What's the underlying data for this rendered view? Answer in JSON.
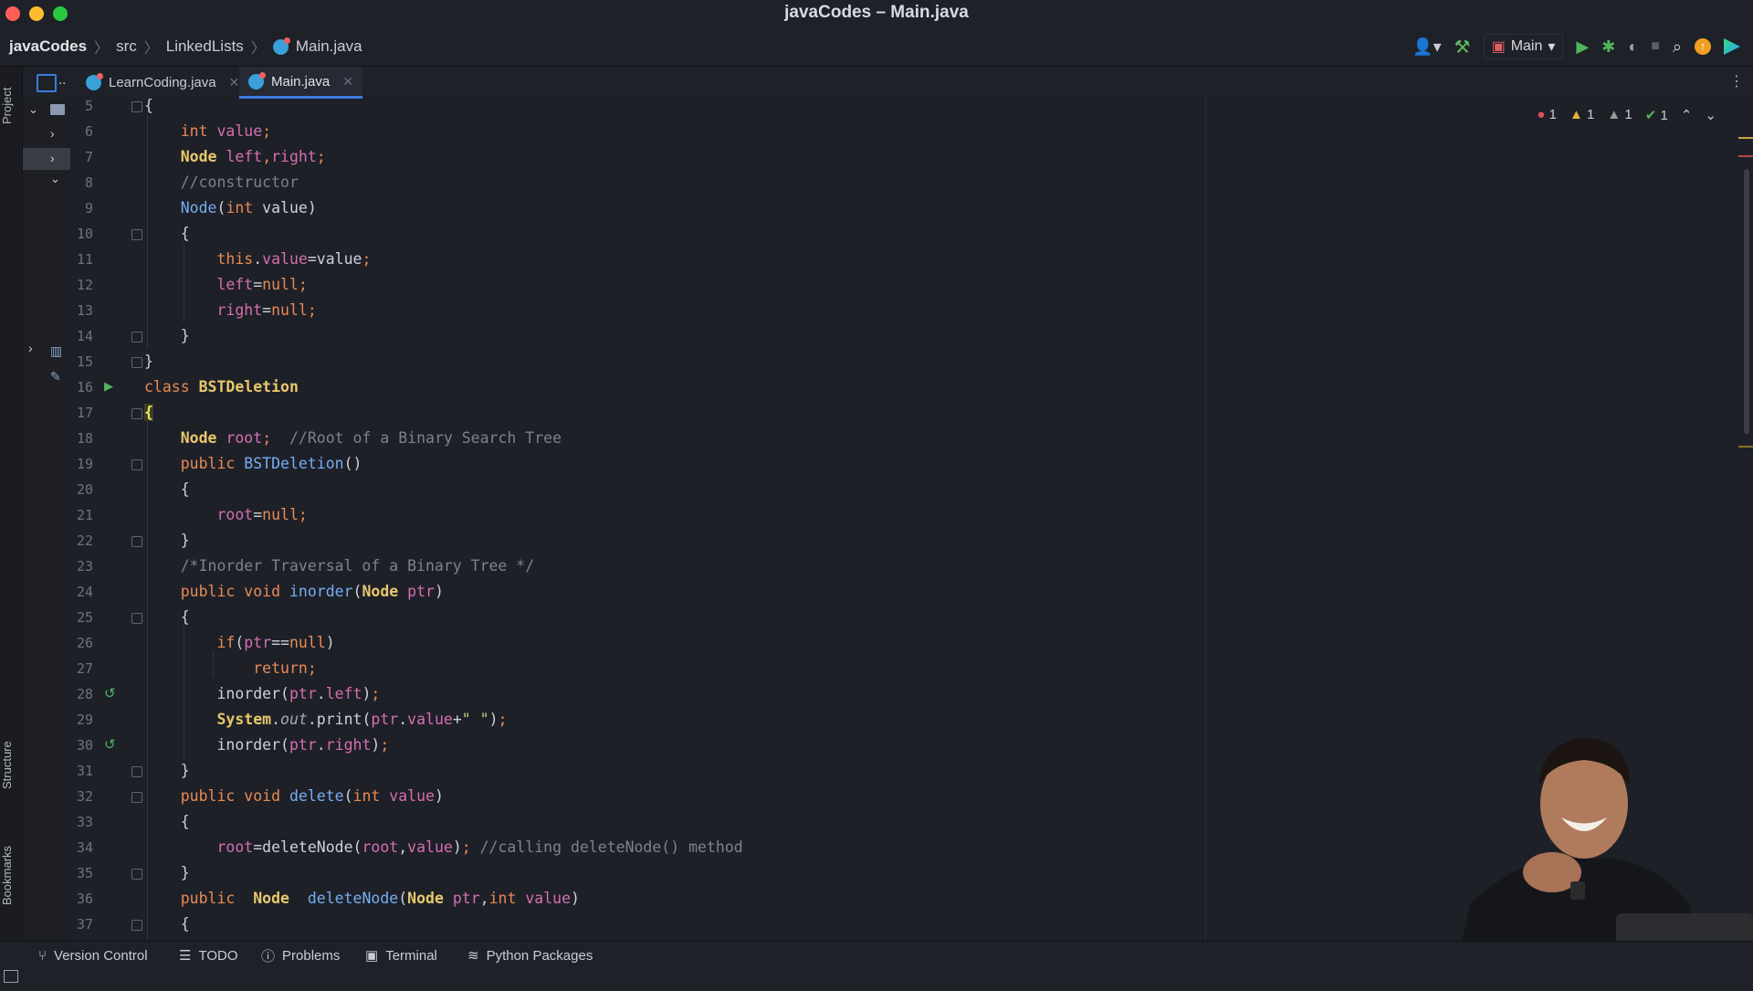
{
  "window": {
    "title": "javaCodes – Main.java",
    "traffic_colors": [
      "#ff5f57",
      "#febc2e",
      "#28c840"
    ]
  },
  "breadcrumb": {
    "project": "javaCodes",
    "items": [
      "src",
      "LinkedLists",
      "Main.java"
    ]
  },
  "toolbar": {
    "run_config": "Main"
  },
  "tabs": [
    {
      "label": "LearnCoding.java",
      "active": false
    },
    {
      "label": "Main.java",
      "active": true
    }
  ],
  "side_panels": {
    "project": "Project",
    "structure": "Structure",
    "bookmarks": "Bookmarks"
  },
  "inspections": {
    "errors": "1",
    "warnings": "1",
    "weak_warnings": "1",
    "typos": "1"
  },
  "editor": {
    "line_numbers": [
      "5",
      "6",
      "7",
      "8",
      "9",
      "10",
      "11",
      "12",
      "13",
      "14",
      "15",
      "16",
      "17",
      "18",
      "19",
      "20",
      "21",
      "22",
      "23",
      "24",
      "25",
      "26",
      "27",
      "28",
      "29",
      "30",
      "31",
      "32",
      "33",
      "34",
      "35",
      "36",
      "37"
    ]
  },
  "bottom_tools": [
    "Version Control",
    "TODO",
    "Problems",
    "Terminal",
    "Python Packages"
  ]
}
